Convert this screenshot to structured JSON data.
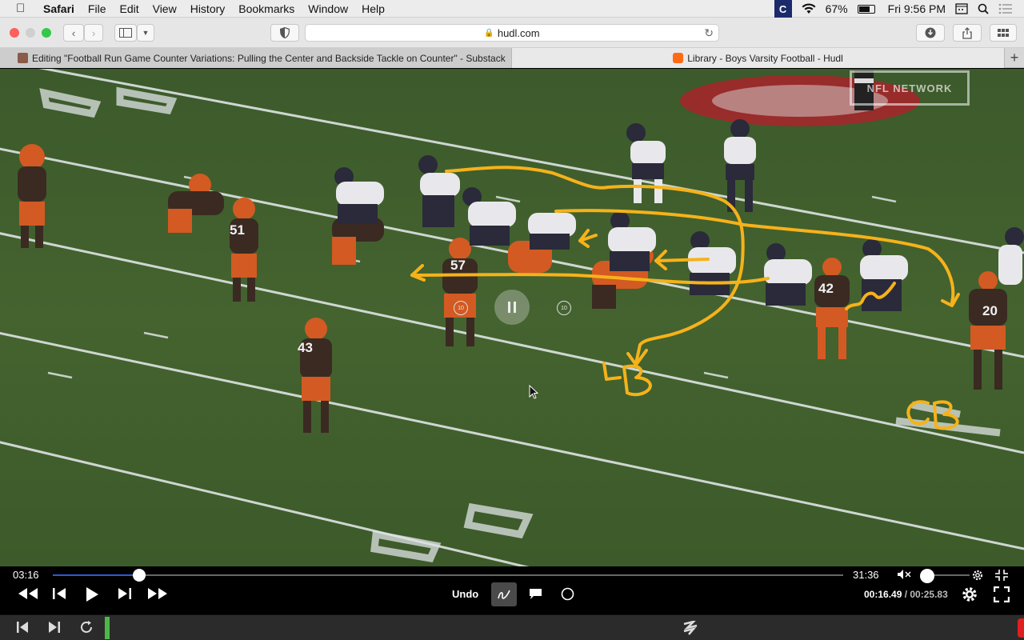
{
  "menubar": {
    "app": "Safari",
    "menus": [
      "File",
      "Edit",
      "View",
      "History",
      "Bookmarks",
      "Window",
      "Help"
    ],
    "app_badge": "C",
    "battery": "67%",
    "clock": "Fri 9:56 PM"
  },
  "toolbar": {
    "url": "hudl.com"
  },
  "tabs": [
    {
      "title": "Editing \"Football Run Game Counter Variations: Pulling the Center and Backside Tackle on Counter\" - Substack"
    },
    {
      "title": "Library - Boys Varsity Football - Hudl"
    }
  ],
  "video": {
    "watermark": "NFL NETWORK",
    "annotations": {
      "lb": "LB",
      "cb": "CB"
    },
    "skip_back": "10",
    "skip_forward": "10",
    "player_numbers": [
      "57",
      "43",
      "42",
      "20"
    ]
  },
  "player": {
    "current_time": "03:16",
    "total_time": "31:36",
    "progress_fraction": 0.109,
    "volume_fraction": 0.05,
    "undo_label": "Undo",
    "clip_time": "00:16.49",
    "clip_total": "/ 00:25.83"
  },
  "colors": {
    "annotation": "#f6b21a",
    "field": "#3f5a2c",
    "progress": "#2a5bd7"
  }
}
